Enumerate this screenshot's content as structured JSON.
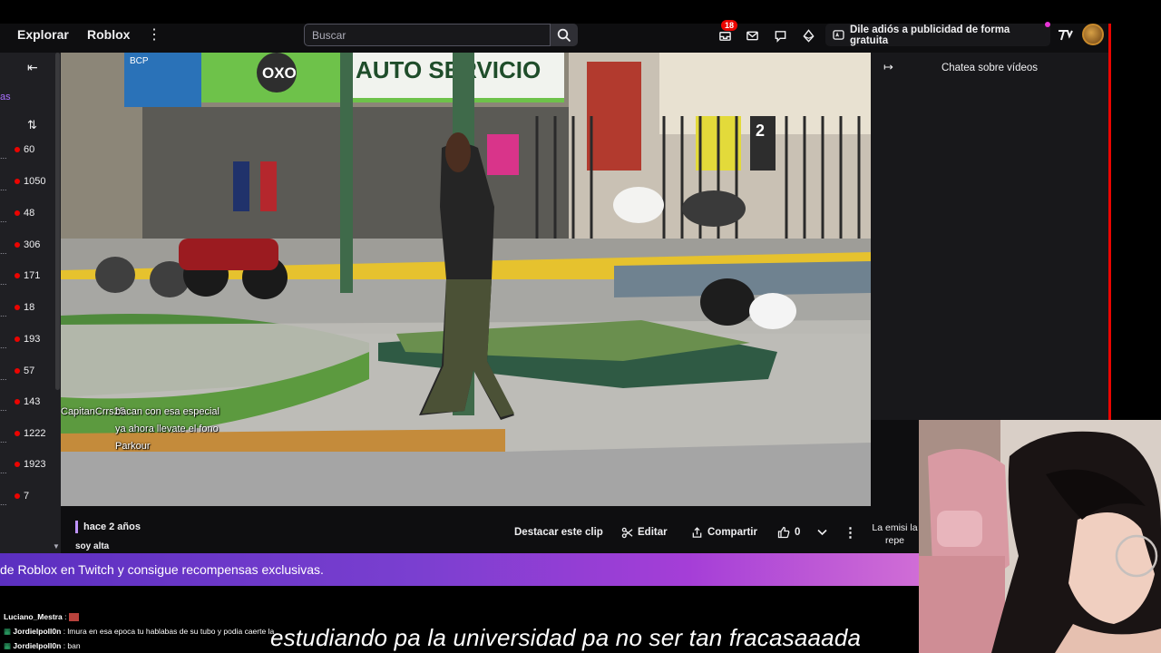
{
  "topbar": {
    "nav": [
      "Explorar",
      "Roblox"
    ],
    "search_placeholder": "Buscar",
    "notifications_count": "18",
    "ad_free_label": "Dile adiós a publicidad de forma gratuita"
  },
  "left_sidebar": {
    "partial_text": "as",
    "viewer_counts": [
      "60",
      "1050",
      "48",
      "306",
      "171",
      "18",
      "193",
      "57",
      "143",
      "1222",
      "1923",
      "7"
    ]
  },
  "video": {
    "overlay_chat": [
      {
        "user": "CapitanCrrs25",
        "text": "bacan con esa especial"
      },
      {
        "user": "",
        "text": "ya ahora llevate el fono"
      },
      {
        "user": "",
        "text": "Parkour"
      }
    ],
    "signs": {
      "store": "AUTO SERVICIO",
      "brand": "OXO",
      "bank": "BCP",
      "sign_number": "2"
    }
  },
  "clip_info": {
    "age": "hace 2 años",
    "title": "soy alta",
    "feature_button": "Destacar este clip",
    "edit_button": "Editar",
    "share_button": "Compartir",
    "like_count": "0"
  },
  "right_chat": {
    "title": "Chatea sobre vídeos",
    "partial_text": "La emisi la repe"
  },
  "banner": {
    "text": "de Roblox en Twitch y consigue recompensas exclusivas."
  },
  "bottom_chat": [
    {
      "user": "Luciano_Mestra",
      "text": ":"
    },
    {
      "user": "Jordielpoll0n",
      "text": ": lmura en esa epoca tu hablabas de su tubo y podia caerte la"
    },
    {
      "user": "Jordielpoll0n",
      "text": ": ban"
    }
  ],
  "subtitle": "estudiando pa la universidad pa no ser tan fracasaaada",
  "colors": {
    "accent": "#9147ff",
    "live_red": "#eb0400",
    "background": "#0e0e10",
    "panel": "#18181b"
  }
}
